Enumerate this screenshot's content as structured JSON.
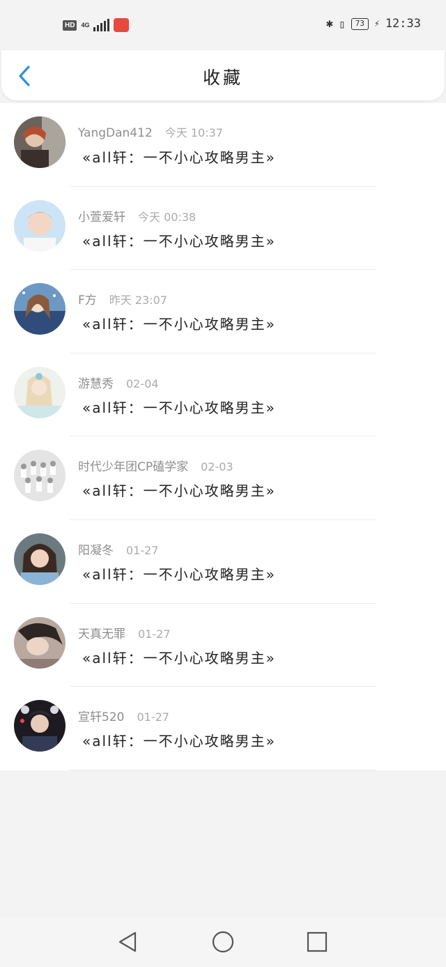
{
  "status_bar": {
    "hd_badge": "HD",
    "network": "4G",
    "battery": "73",
    "time": "12:33"
  },
  "header": {
    "title": "收藏"
  },
  "items": [
    {
      "user": "YangDan412",
      "time": "今天 10:37",
      "content": "«all轩：一不小心攻略男主»"
    },
    {
      "user": "小萱爱轩",
      "time": "今天 00:38",
      "content": "«all轩：一不小心攻略男主»"
    },
    {
      "user": "F方",
      "time": "昨天 23:07",
      "content": "«all轩：一不小心攻略男主»"
    },
    {
      "user": "游慧秀",
      "time": "02-04",
      "content": "«all轩：一不小心攻略男主»"
    },
    {
      "user": "时代少年团CP磕学家",
      "time": "02-03",
      "content": "«all轩：一不小心攻略男主»"
    },
    {
      "user": "阳凝冬",
      "time": "01-27",
      "content": "«all轩：一不小心攻略男主»"
    },
    {
      "user": "天真无罪",
      "time": "01-27",
      "content": "«all轩：一不小心攻略男主»"
    },
    {
      "user": "宣轩520",
      "time": "01-27",
      "content": "«all轩：一不小心攻略男主»"
    }
  ],
  "colors": {
    "accent": "#2f8fe0",
    "background": "#f3f3f3"
  },
  "icons": {
    "back": "chevron-left-icon",
    "nav_back": "triangle-back-icon",
    "nav_home": "circle-home-icon",
    "nav_recent": "square-recent-icon"
  }
}
